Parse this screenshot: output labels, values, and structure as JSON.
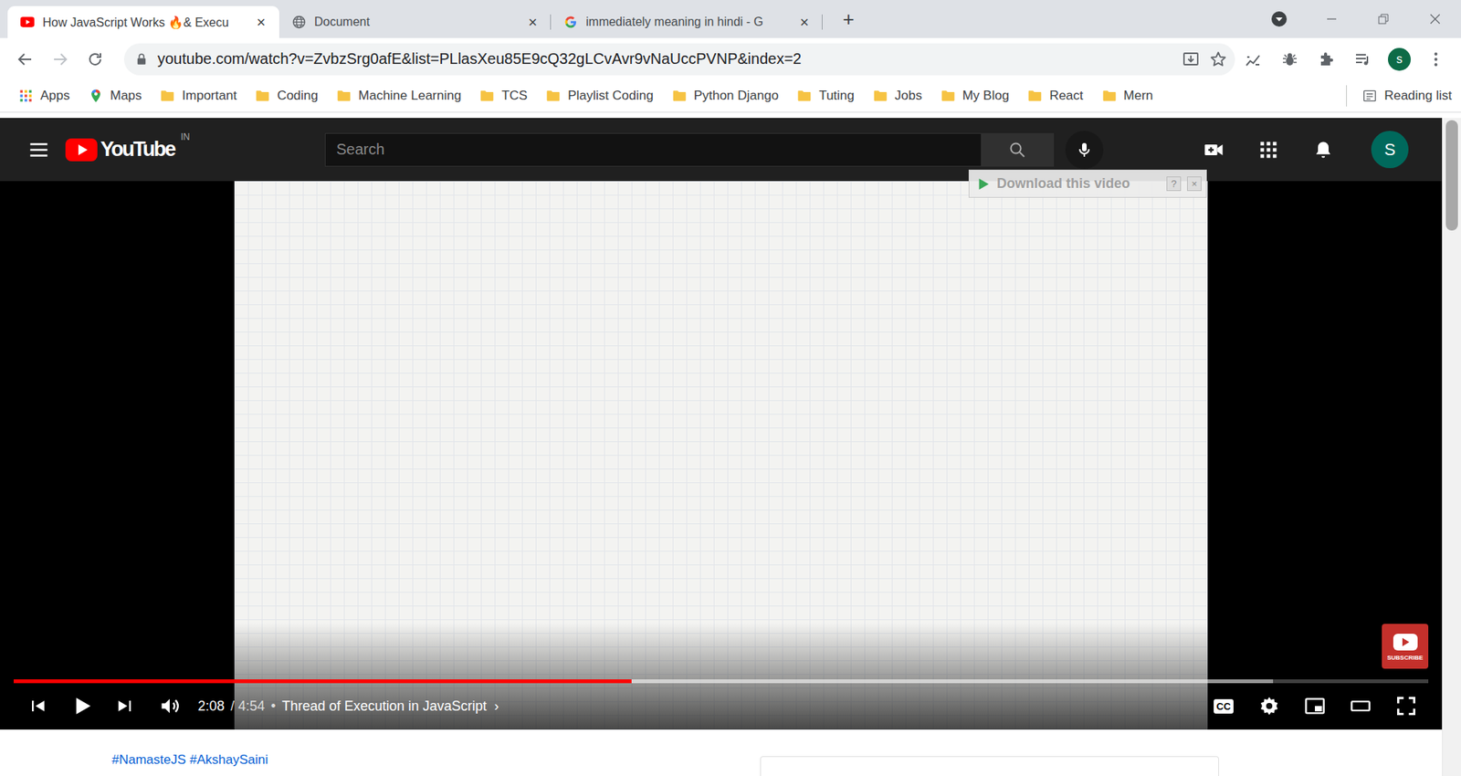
{
  "browser": {
    "tabs": [
      {
        "label": "How JavaScript Works 🔥& Execu",
        "close": "×",
        "selected": true,
        "kind": "youtube"
      },
      {
        "label": "Document",
        "close": "×",
        "selected": false,
        "kind": "page"
      },
      {
        "label": "immediately meaning in hindi - G",
        "close": "×",
        "selected": false,
        "kind": "google"
      }
    ],
    "new_tab": "+",
    "address": "youtube.com/watch?v=ZvbzSrg0afE&list=PLlasXeu85E9cQ32gLCvAvr9vNaUccPVNP&index=2",
    "profile": "s",
    "bookmarks": [
      {
        "label": "Apps",
        "kind": "apps"
      },
      {
        "label": "Maps",
        "kind": "maps"
      },
      {
        "label": "Important",
        "kind": "folder"
      },
      {
        "label": "Coding",
        "kind": "folder"
      },
      {
        "label": "Machine Learning",
        "kind": "folder"
      },
      {
        "label": "TCS",
        "kind": "folder"
      },
      {
        "label": "Playlist Coding",
        "kind": "folder"
      },
      {
        "label": "Python Django",
        "kind": "folder"
      },
      {
        "label": "Tuting",
        "kind": "folder"
      },
      {
        "label": "Jobs",
        "kind": "folder"
      },
      {
        "label": "My Blog",
        "kind": "folder"
      },
      {
        "label": "React",
        "kind": "folder"
      },
      {
        "label": "Mern",
        "kind": "folder"
      }
    ],
    "reading_list": "Reading list"
  },
  "youtube": {
    "logo": "YouTube",
    "country": "IN",
    "search": {
      "placeholder": "Search"
    },
    "avatar": "S",
    "player": {
      "paused": true,
      "progress": {
        "level": 0.437
      },
      "buffered": {
        "level": 0.89
      },
      "current_time": "2:08",
      "duration": "/ 4:54",
      "separator": "•",
      "chapter": "Thread of Execution in JavaScript",
      "chapter_arrow": "›",
      "captions": "CC"
    },
    "download_overlay": {
      "label": "Download this video",
      "help": "?",
      "close": "×"
    },
    "watermark": "SUBSCRIBE",
    "hashtags": [
      "#NamasteJS",
      "#AkshaySaini"
    ]
  }
}
